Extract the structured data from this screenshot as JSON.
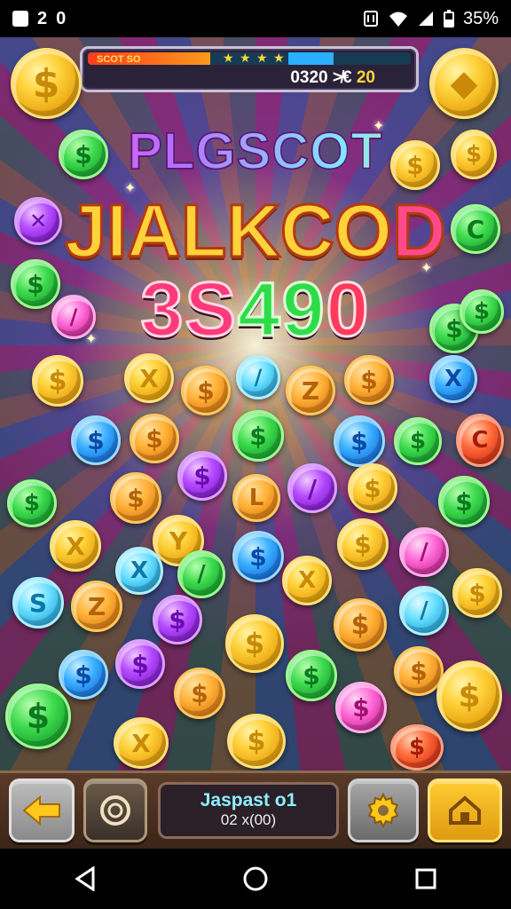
{
  "status_bar": {
    "left_icons": [
      "gallery-icon",
      "notification-icon",
      "sim-icon"
    ],
    "left_glyphs": [
      "2",
      "0"
    ],
    "right_icons": [
      "nfc-icon",
      "wifi-icon",
      "signal-icon",
      "battery-icon"
    ],
    "battery_text": "35%"
  },
  "hud": {
    "label": "SCOT SO",
    "stars": "★ ★ ★ ★",
    "score_prefix": "0320 ",
    "score_mid": "≯€",
    "score_suffix": " 20",
    "red_progress": 0.38
  },
  "title": {
    "line1": "PLGSCOT",
    "line2_main": "JIALKCO",
    "line2_end": "D",
    "line3": [
      "3",
      "S",
      "4",
      "9",
      "0"
    ]
  },
  "bottom_panel": {
    "label": "Jaspast o1",
    "value": "02 x(00)"
  },
  "icons": {
    "back": "arrow-left-icon",
    "spin": "spin-ring-icon",
    "settings": "gear-icon",
    "home": "home-icon"
  },
  "colors": {
    "accent_gold": "#ffd23a",
    "home_button": "#ffcc33",
    "jackpot_text": "#8ef0ff"
  }
}
